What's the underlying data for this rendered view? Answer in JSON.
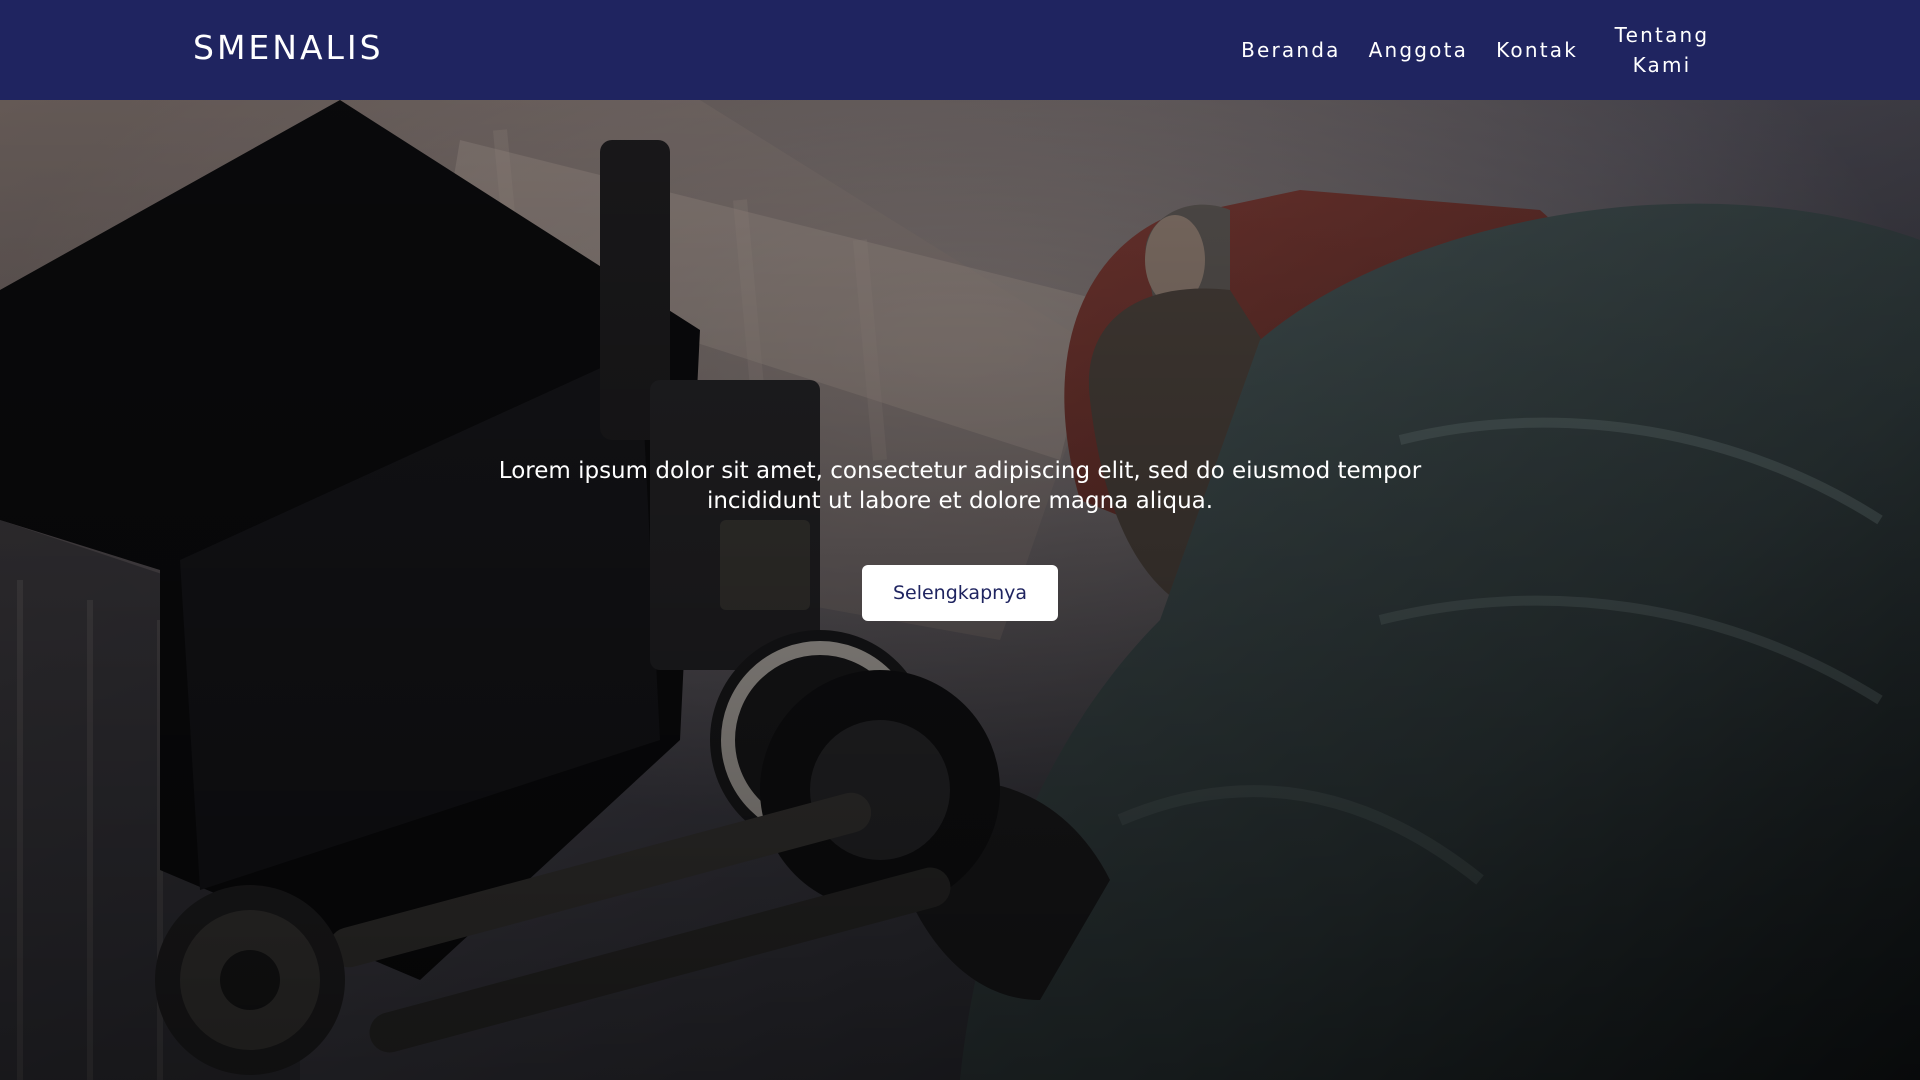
{
  "navbar": {
    "brand": "SMENALIS",
    "background_color": "#1f2460",
    "links": [
      {
        "label": "Beranda"
      },
      {
        "label": "Anggota"
      },
      {
        "label": "Kontak"
      },
      {
        "label": "Tentang Kami"
      }
    ]
  },
  "hero": {
    "background_image": "camera-operator-photo",
    "text": "Lorem ipsum dolor sit amet, consectetur adipiscing elit, sed do eiusmod tempor incididunt ut labore et dolore magna aliqua.",
    "button_label": "Selengkapnya"
  }
}
